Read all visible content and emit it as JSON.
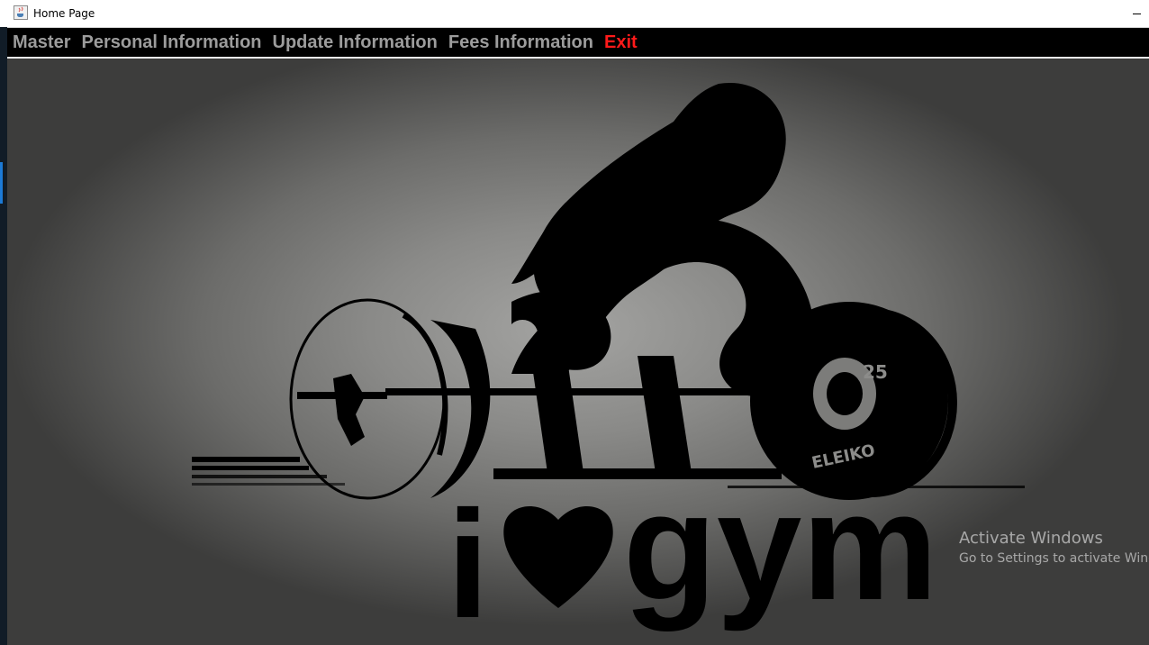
{
  "window": {
    "title": "Home Page",
    "icon": "java-cup-icon"
  },
  "menu": {
    "items": [
      {
        "label": "Master"
      },
      {
        "label": "Personal Information"
      },
      {
        "label": "Update Information"
      },
      {
        "label": "Fees Information"
      },
      {
        "label": "Exit",
        "color": "#ff1a1a"
      }
    ]
  },
  "banner": {
    "text_i": "i",
    "text_gym": "gym",
    "plate_number": "25",
    "plate_brand": "ELEIKO"
  },
  "watermark": {
    "title": "Activate Windows",
    "subtitle": "Go to Settings to activate Windows."
  }
}
